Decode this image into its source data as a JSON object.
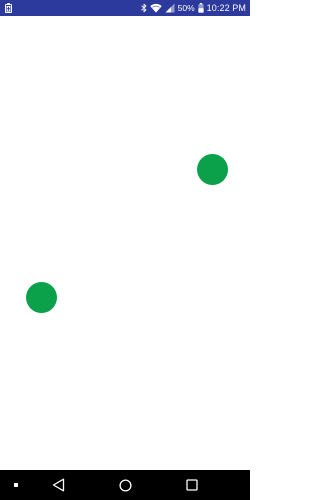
{
  "status_bar": {
    "time": "10:22 PM",
    "battery_percent": "50%",
    "icons": [
      "battery-saver-icon",
      "bluetooth-icon",
      "wifi-icon",
      "signal-icon",
      "battery-icon"
    ],
    "background_color": "#2b3a9c"
  },
  "content": {
    "dots": [
      {
        "name": "dot-1",
        "color": "#0aa14a"
      },
      {
        "name": "dot-2",
        "color": "#0aa14a"
      }
    ]
  },
  "nav_bar": {
    "icons": [
      "dot-icon",
      "back-icon",
      "home-icon",
      "overview-icon"
    ],
    "background_color": "#000000"
  }
}
